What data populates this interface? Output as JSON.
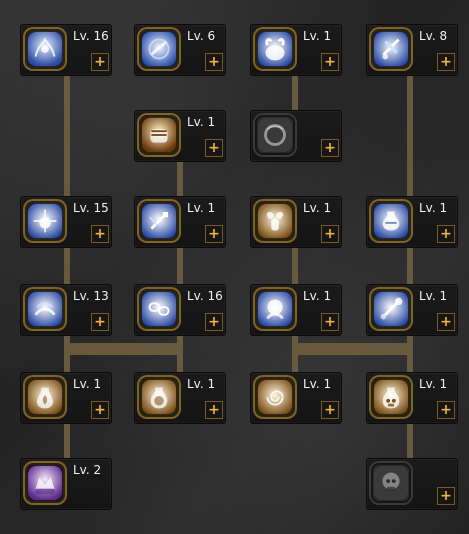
{
  "skills": [
    {
      "id": "r1c1",
      "level": "Lv. 16",
      "icon": "spirit-totem-icon",
      "colors": {
        "a": "#b9d6ff",
        "b": "#2f56b7"
      },
      "locked": false
    },
    {
      "id": "r1c2",
      "level": "Lv. 6",
      "icon": "blade-swirl-icon",
      "colors": {
        "a": "#d6e7ff",
        "b": "#2b4ea8"
      },
      "locked": false
    },
    {
      "id": "r1c3",
      "level": "Lv. 1",
      "icon": "horned-helm-icon",
      "colors": {
        "a": "#e9ecff",
        "b": "#2b4aa1"
      },
      "locked": false
    },
    {
      "id": "r1c4",
      "level": "Lv. 8",
      "icon": "scroll-blades-icon",
      "colors": {
        "a": "#cfe2ff",
        "b": "#2b4aa1"
      },
      "locked": false
    },
    {
      "id": "r2c2",
      "level": "Lv. 1",
      "icon": "fist-icon",
      "colors": {
        "a": "#ffd27a",
        "b": "#6b3b0b"
      },
      "locked": false
    },
    {
      "id": "r2c3",
      "level": "",
      "icon": "locked-ring-icon",
      "colors": {
        "a": "#bfbfbf",
        "b": "#444444"
      },
      "locked": true
    },
    {
      "id": "r3c1",
      "level": "Lv. 15",
      "icon": "light-burst-icon",
      "colors": {
        "a": "#d5e8ff",
        "b": "#2b4aa1"
      },
      "locked": false
    },
    {
      "id": "r3c2",
      "level": "Lv. 1",
      "icon": "arrow-burst-icon",
      "colors": {
        "a": "#e2f0ff",
        "b": "#2b4aa1"
      },
      "locked": false
    },
    {
      "id": "r3c3",
      "level": "Lv. 1",
      "icon": "ram-horns-icon",
      "colors": {
        "a": "#ffe7b3",
        "b": "#7a4e16"
      },
      "locked": false
    },
    {
      "id": "r3c4",
      "level": "Lv. 1",
      "icon": "potion-blue-icon",
      "colors": {
        "a": "#d9e9ff",
        "b": "#2b4aa1"
      },
      "locked": false
    },
    {
      "id": "r4c1",
      "level": "Lv. 13",
      "icon": "shockwave-icon",
      "colors": {
        "a": "#d5e8ff",
        "b": "#2b4aa1"
      },
      "locked": false
    },
    {
      "id": "r4c2",
      "level": "Lv. 16",
      "icon": "chain-icon",
      "colors": {
        "a": "#e2f0ff",
        "b": "#2b4aa1"
      },
      "locked": false
    },
    {
      "id": "r4c3",
      "level": "Lv. 1",
      "icon": "orb-icon",
      "colors": {
        "a": "#e7f3ff",
        "b": "#2b4aa1"
      },
      "locked": false
    },
    {
      "id": "r4c4",
      "level": "Lv. 1",
      "icon": "staff-icon",
      "colors": {
        "a": "#e7f3ff",
        "b": "#2b4aa1"
      },
      "locked": false
    },
    {
      "id": "r5c1",
      "level": "Lv. 1",
      "icon": "flame-flask-icon",
      "colors": {
        "a": "#ffe2a8",
        "b": "#7a4e16"
      },
      "locked": false
    },
    {
      "id": "r5c2",
      "level": "Lv. 1",
      "icon": "potion-gold-icon",
      "colors": {
        "a": "#ffe2a8",
        "b": "#7a4e16"
      },
      "locked": false
    },
    {
      "id": "r5c3",
      "level": "Lv. 1",
      "icon": "spiral-icon",
      "colors": {
        "a": "#ffe2a8",
        "b": "#7a4e16"
      },
      "locked": false
    },
    {
      "id": "r5c4",
      "level": "Lv. 1",
      "icon": "skull-flask-icon",
      "colors": {
        "a": "#ffe2a8",
        "b": "#7a4e16"
      },
      "locked": false
    },
    {
      "id": "r6c1",
      "level": "Lv. 2",
      "icon": "shadow-crown-icon",
      "colors": {
        "a": "#ecd6ff",
        "b": "#5b2a8a"
      },
      "locked": false
    },
    {
      "id": "r6c4",
      "level": "",
      "icon": "locked-skull-icon",
      "colors": {
        "a": "#bfbfbf",
        "b": "#444444"
      },
      "locked": true
    }
  ],
  "ui": {
    "plus_label": "+",
    "line_color": "#6b5a3a"
  }
}
